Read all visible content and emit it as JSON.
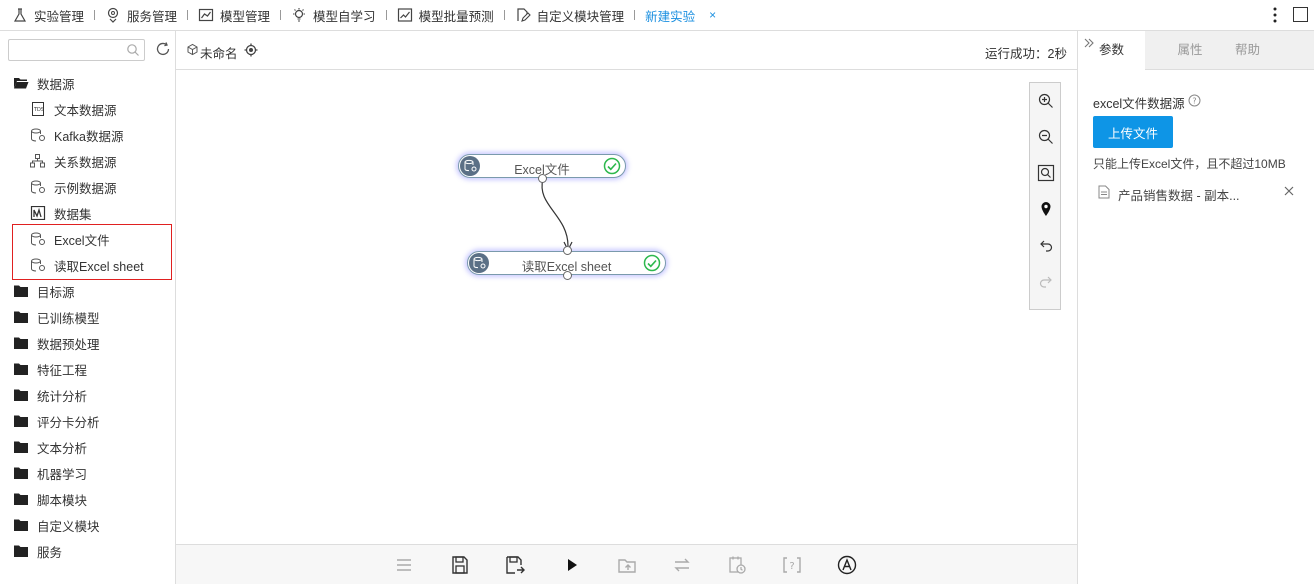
{
  "topnav": {
    "items": [
      {
        "label": "实验管理",
        "icon": "flask-icon"
      },
      {
        "label": "服务管理",
        "icon": "location-icon"
      },
      {
        "label": "模型管理",
        "icon": "chart-box-icon"
      },
      {
        "label": "模型自学习",
        "icon": "lightbulb-icon"
      },
      {
        "label": "模型批量预测",
        "icon": "line-chart-icon"
      },
      {
        "label": "自定义模块管理",
        "icon": "pen-doc-icon"
      }
    ],
    "active_tab": "新建实验",
    "close_label": "×",
    "accent_color": "#1a8fe0"
  },
  "sidebar": {
    "search_placeholder": "",
    "datasource": {
      "label": "数据源",
      "children": [
        {
          "label": "文本数据源",
          "icon": "text-file-icon"
        },
        {
          "label": "Kafka数据源",
          "icon": "database-gear-icon"
        },
        {
          "label": "关系数据源",
          "icon": "relation-icon"
        },
        {
          "label": "示例数据源",
          "icon": "database-gear-icon"
        },
        {
          "label": "数据集",
          "icon": "dataset-icon"
        },
        {
          "label": "Excel文件",
          "icon": "database-gear-icon"
        },
        {
          "label": "读取Excel sheet",
          "icon": "database-gear-icon"
        }
      ]
    },
    "folders": [
      "目标源",
      "已训练模型",
      "数据预处理",
      "特征工程",
      "统计分析",
      "评分卡分析",
      "文本分析",
      "机器学习",
      "脚本模块",
      "自定义模块",
      "服务"
    ],
    "highlight_color": "#e02020"
  },
  "canvas": {
    "experiment_name": "未命名",
    "run_status": "运行成功：2秒",
    "nodes": [
      {
        "label": "Excel文件",
        "status": "success"
      },
      {
        "label": "读取Excel sheet",
        "status": "success"
      }
    ],
    "zoom_tools": [
      "zoom-in-icon",
      "zoom-out-icon",
      "fit-view-icon",
      "locate-icon",
      "undo-icon",
      "redo-icon"
    ],
    "bottom_tools": [
      "list-icon",
      "save-icon",
      "save-as-icon",
      "run-icon",
      "export-icon",
      "sync-icon",
      "schedule-icon",
      "help-bracket-icon",
      "auto-layout-icon"
    ]
  },
  "rightpanel": {
    "tabs": [
      "参数",
      "属性",
      "帮助"
    ],
    "param_title": "excel文件数据源",
    "upload_label": "上传文件",
    "upload_hint": "只能上传Excel文件，且不超过10MB",
    "file_name": "产品销售数据 - 副本...",
    "button_color": "#0e95e6"
  }
}
